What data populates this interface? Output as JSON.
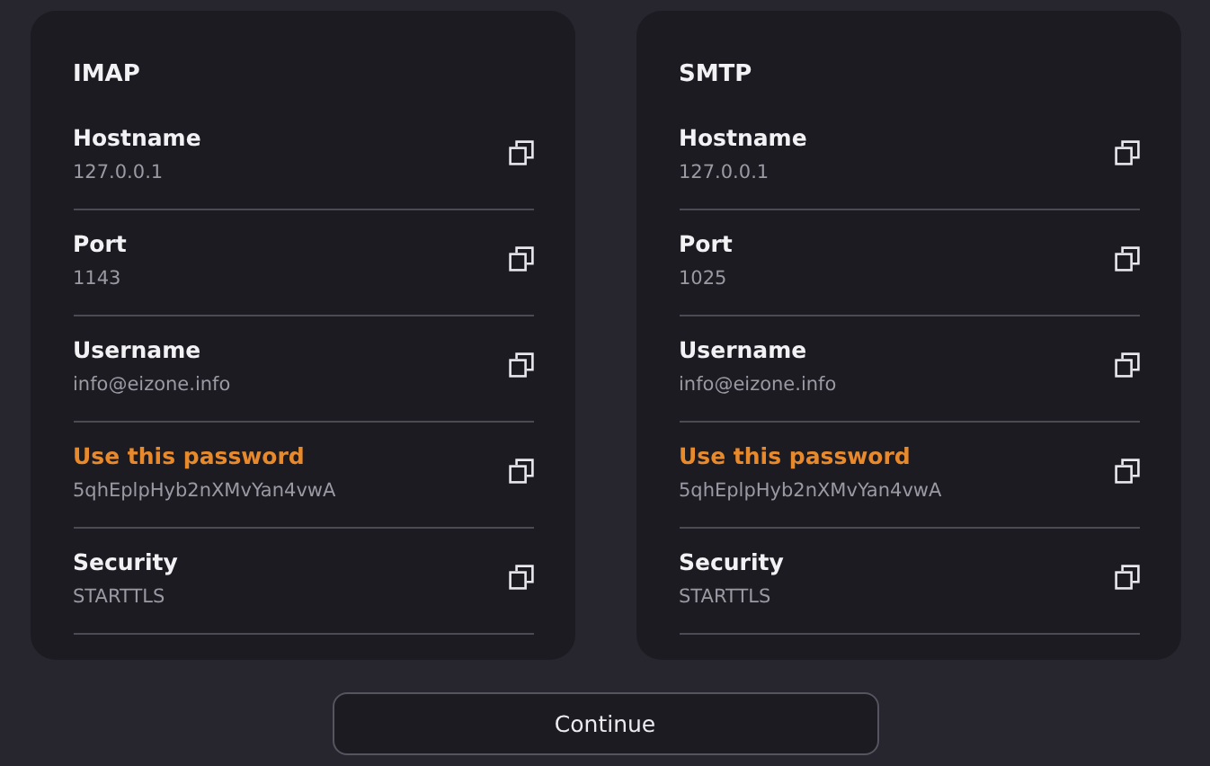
{
  "panels": [
    {
      "title": "IMAP",
      "fields": [
        {
          "label": "Hostname",
          "value": "127.0.0.1",
          "highlighted": false
        },
        {
          "label": "Port",
          "value": "1143",
          "highlighted": false
        },
        {
          "label": "Username",
          "value": "info@eizone.info",
          "highlighted": false
        },
        {
          "label": "Use this password",
          "value": "5qhEplpHyb2nXMvYan4vwA",
          "highlighted": true
        },
        {
          "label": "Security",
          "value": "STARTTLS",
          "highlighted": false
        }
      ]
    },
    {
      "title": "SMTP",
      "fields": [
        {
          "label": "Hostname",
          "value": "127.0.0.1",
          "highlighted": false
        },
        {
          "label": "Port",
          "value": "1025",
          "highlighted": false
        },
        {
          "label": "Username",
          "value": "info@eizone.info",
          "highlighted": false
        },
        {
          "label": "Use this password",
          "value": "5qhEplpHyb2nXMvYan4vwA",
          "highlighted": true
        },
        {
          "label": "Security",
          "value": "STARTTLS",
          "highlighted": false
        }
      ]
    }
  ],
  "button": "Continue"
}
